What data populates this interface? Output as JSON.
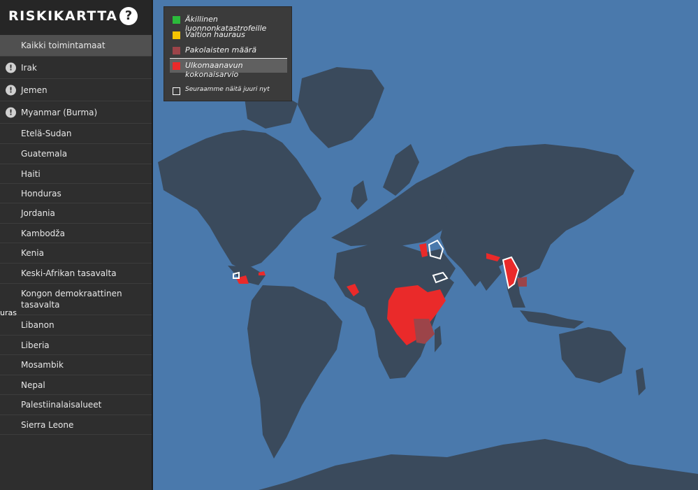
{
  "sidebar": {
    "title": "RISKIKARTTA",
    "help_label": "?",
    "items": [
      {
        "label": "Kaikki toimintamaat",
        "selected": true
      },
      {
        "label": "Irak",
        "warning": true
      },
      {
        "label": "Jemen",
        "warning": true
      },
      {
        "label": "Myanmar (Burma)",
        "warning": true
      },
      {
        "label": "Etelä-Sudan"
      },
      {
        "label": "Guatemala"
      },
      {
        "label": "Haiti"
      },
      {
        "label": "Honduras"
      },
      {
        "label": "Jordania"
      },
      {
        "label": "Kambodža"
      },
      {
        "label": "Kenia"
      },
      {
        "label": "Keski-Afrikan tasavalta"
      },
      {
        "label": "Kongon demokraattinen tasavalta"
      },
      {
        "label": "Libanon"
      },
      {
        "label": "Liberia"
      },
      {
        "label": "Mosambik"
      },
      {
        "label": "Nepal"
      },
      {
        "label": "Palestiinalaisalueet"
      },
      {
        "label": "Sierra Leone"
      }
    ],
    "warning_glyph": "!"
  },
  "edge_text": "uras",
  "legend": {
    "items": [
      {
        "label": "Äkillinen luonnonkatastrofeille",
        "color": "#2bbb3b",
        "icon": "green-square-icon"
      },
      {
        "label": "Valtion hauraus",
        "color": "#f5c400",
        "icon": "yellow-square-icon"
      },
      {
        "label": "Pakolaisten määrä",
        "color": "#9c4449",
        "icon": "dark-red-square-icon"
      },
      {
        "label": "Ulkomaanavun kokonaisarvio",
        "color": "#ea2a2a",
        "icon": "red-square-icon",
        "active": true
      }
    ],
    "watching": {
      "label": "Seuraamme näitä juuri nyt",
      "icon": "white-outline-square-icon"
    }
  },
  "map": {
    "ocean_color": "#4a79ac",
    "land_color": "#3a4a5c",
    "highlight_colors": {
      "aid": "#ea2a2a",
      "refugees": "#9c4449",
      "watch_outline": "#ffffff"
    }
  }
}
